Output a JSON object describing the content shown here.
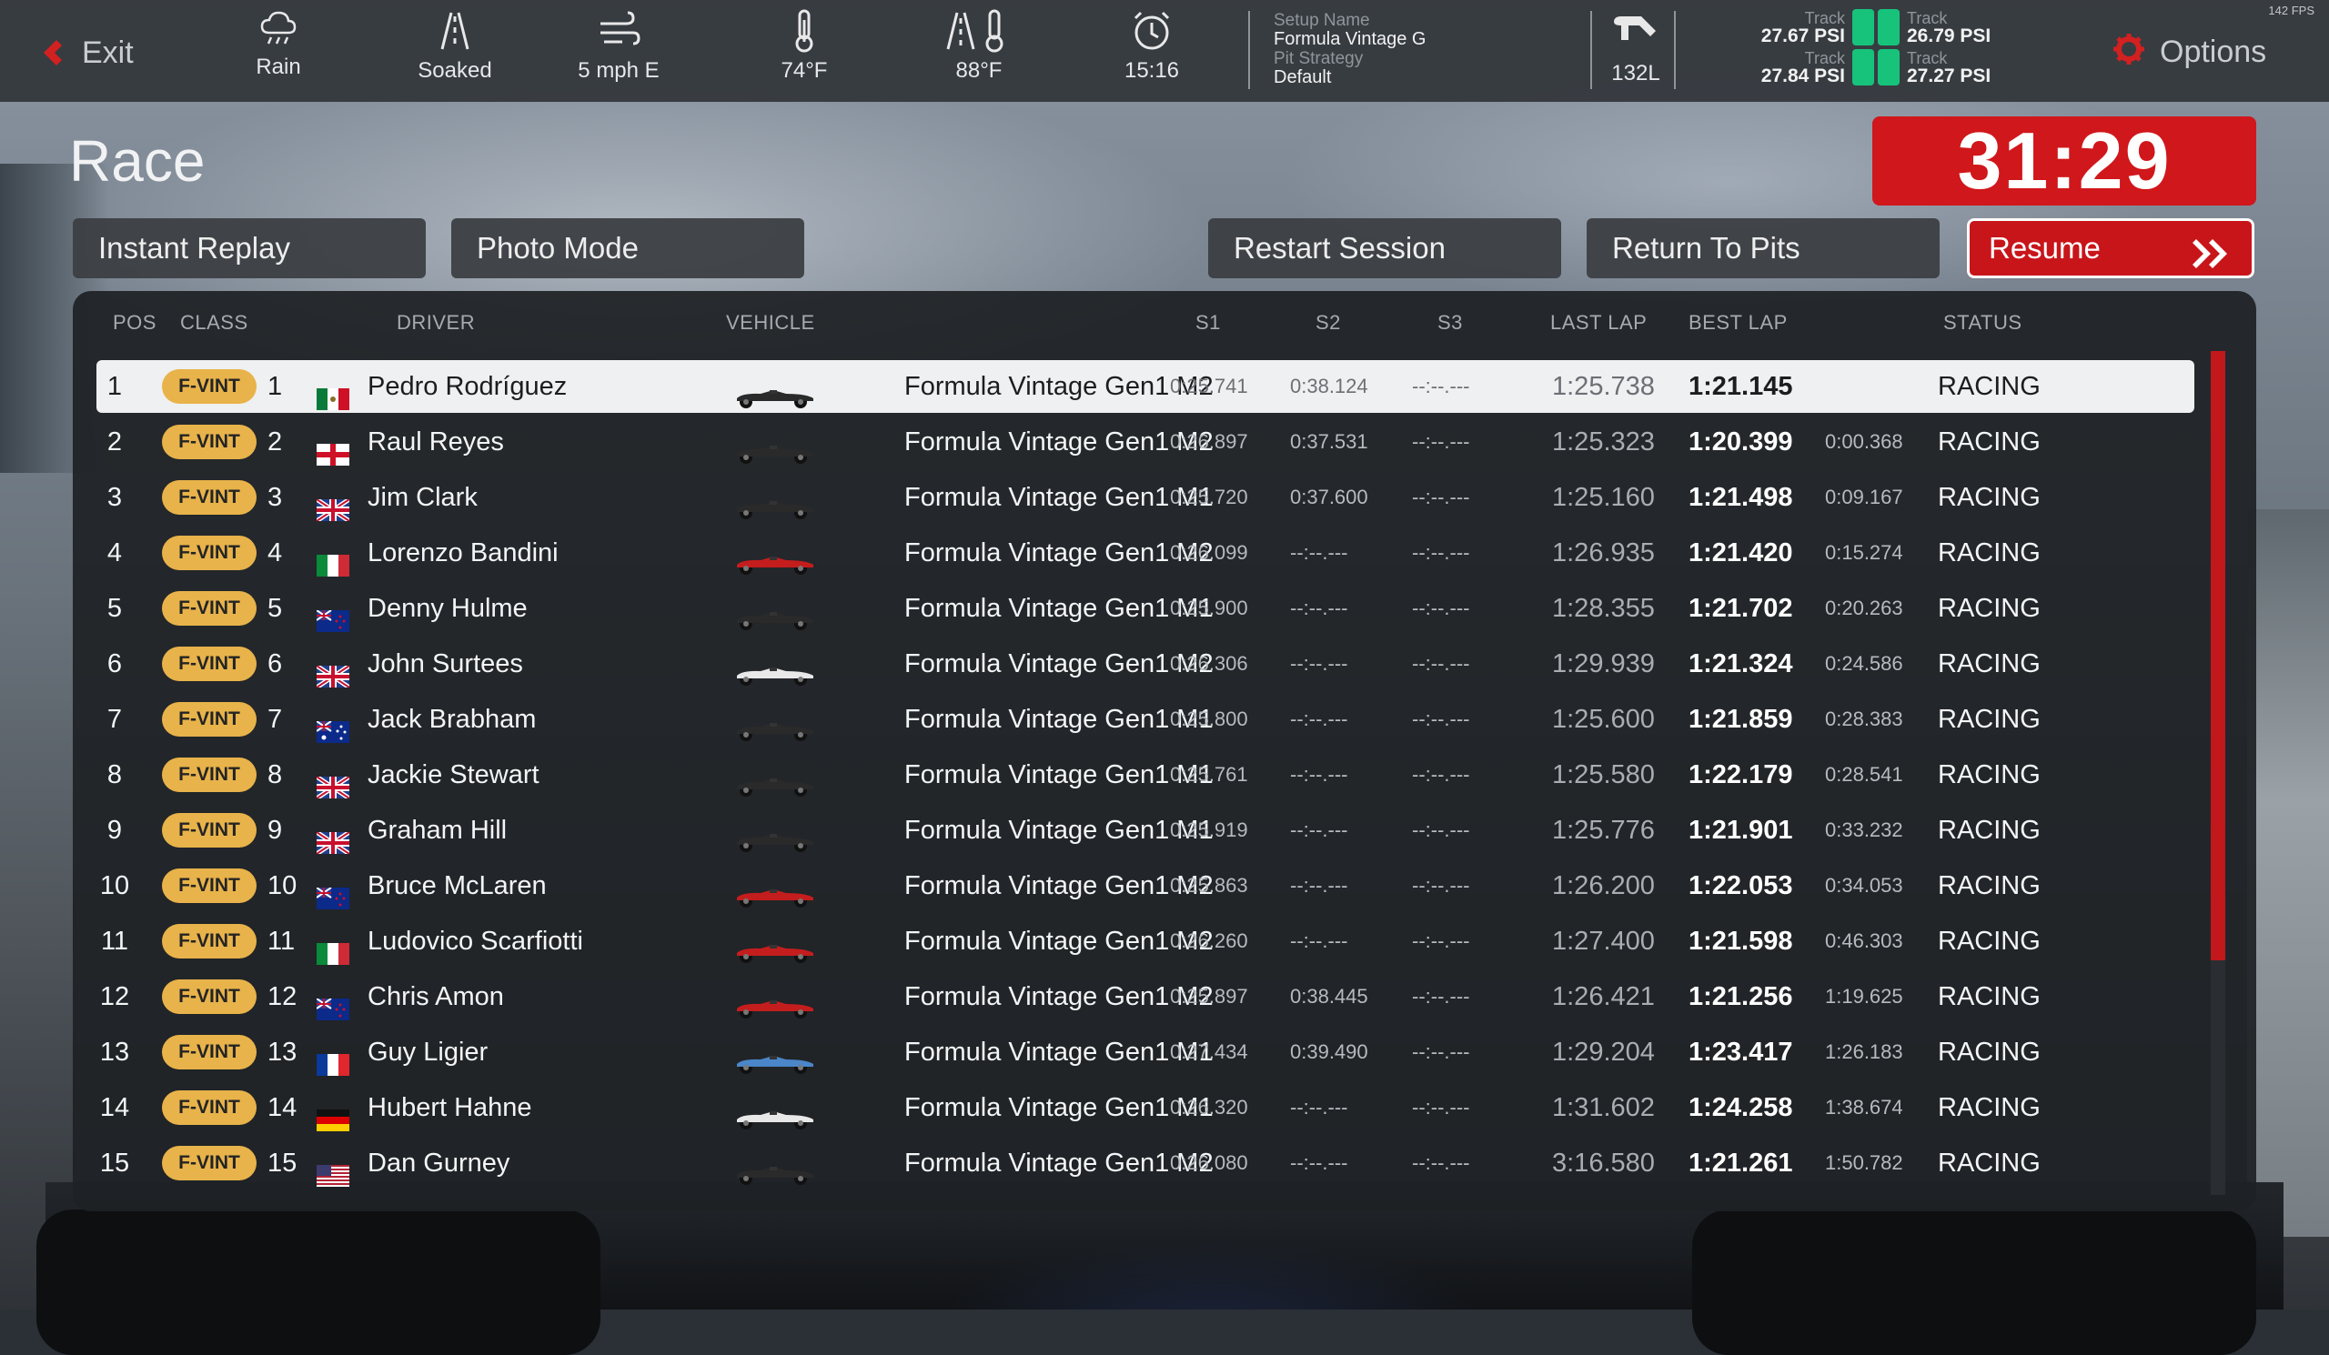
{
  "topbar": {
    "exit_label": "Exit",
    "weather": [
      {
        "icon": "rain-cloud-icon",
        "label": "Rain"
      },
      {
        "icon": "track-wetness-icon",
        "label": "Soaked"
      },
      {
        "icon": "wind-icon",
        "label": "5 mph E"
      },
      {
        "icon": "air-temperature-icon",
        "label": "74°F"
      },
      {
        "icon": "track-temperature-icon",
        "label": "88°F"
      },
      {
        "icon": "clock-icon",
        "label": "15:16"
      }
    ],
    "setup": {
      "name_key": "Setup Name",
      "name_value": "Formula Vintage G",
      "strategy_key": "Pit Strategy",
      "strategy_value": "Default"
    },
    "fuel": {
      "icon": "fuel-nozzle-icon",
      "label": "132L"
    },
    "tyres": {
      "fl": {
        "key": "Track",
        "value": "27.67 PSI"
      },
      "fr": {
        "key": "Track",
        "value": "26.79 PSI"
      },
      "rl": {
        "key": "Track",
        "value": "27.84 PSI"
      },
      "rr": {
        "key": "Track",
        "value": "27.27 PSI"
      }
    },
    "options_label": "Options",
    "fps": "142 FPS"
  },
  "page": {
    "title": "Race",
    "timer": "31:29"
  },
  "buttons": {
    "instant_replay": "Instant Replay",
    "photo_mode": "Photo Mode",
    "restart_session": "Restart Session",
    "return_to_pits": "Return To Pits",
    "resume": "Resume"
  },
  "table": {
    "headers": {
      "pos": "POS",
      "class": "CLASS",
      "driver": "DRIVER",
      "vehicle": "VEHICLE",
      "s1": "S1",
      "s2": "S2",
      "s3": "S3",
      "last_lap": "LAST LAP",
      "best_lap": "BEST LAP",
      "status": "STATUS"
    },
    "rows": [
      {
        "pos": "1",
        "class": "F-VINT",
        "num": "1",
        "flag": "mexico",
        "driver": "Pedro Rodríguez",
        "car_color": "#2a2a2a",
        "vehicle": "Formula Vintage Gen1 M2",
        "s1": "0:25.741",
        "s2": "0:38.124",
        "s3": "--:--.---",
        "last": "1:25.738",
        "best": "1:21.145",
        "gap": "",
        "status": "RACING"
      },
      {
        "pos": "2",
        "class": "F-VINT",
        "num": "2",
        "flag": "england",
        "driver": "Raul Reyes",
        "car_color": "#2a2a2a",
        "vehicle": "Formula Vintage Gen1 M2",
        "s1": "0:26.897",
        "s2": "0:37.531",
        "s3": "--:--.---",
        "last": "1:25.323",
        "best": "1:20.399",
        "gap": "0:00.368",
        "status": "RACING"
      },
      {
        "pos": "3",
        "class": "F-VINT",
        "num": "3",
        "flag": "uk",
        "driver": "Jim Clark",
        "car_color": "#2a2a2a",
        "vehicle": "Formula Vintage Gen1 M1",
        "s1": "0:25.720",
        "s2": "0:37.600",
        "s3": "--:--.---",
        "last": "1:25.160",
        "best": "1:21.498",
        "gap": "0:09.167",
        "status": "RACING"
      },
      {
        "pos": "4",
        "class": "F-VINT",
        "num": "4",
        "flag": "italy",
        "driver": "Lorenzo Bandini",
        "car_color": "#c41d1d",
        "vehicle": "Formula Vintage Gen1 M2",
        "s1": "0:26.099",
        "s2": "--:--.---",
        "s3": "--:--.---",
        "last": "1:26.935",
        "best": "1:21.420",
        "gap": "0:15.274",
        "status": "RACING"
      },
      {
        "pos": "5",
        "class": "F-VINT",
        "num": "5",
        "flag": "new-zealand",
        "driver": "Denny Hulme",
        "car_color": "#2a2a2a",
        "vehicle": "Formula Vintage Gen1 M1",
        "s1": "0:25.900",
        "s2": "--:--.---",
        "s3": "--:--.---",
        "last": "1:28.355",
        "best": "1:21.702",
        "gap": "0:20.263",
        "status": "RACING"
      },
      {
        "pos": "6",
        "class": "F-VINT",
        "num": "6",
        "flag": "uk",
        "driver": "John Surtees",
        "car_color": "#e8e8e8",
        "vehicle": "Formula Vintage Gen1 M2",
        "s1": "0:26.306",
        "s2": "--:--.---",
        "s3": "--:--.---",
        "last": "1:29.939",
        "best": "1:21.324",
        "gap": "0:24.586",
        "status": "RACING"
      },
      {
        "pos": "7",
        "class": "F-VINT",
        "num": "7",
        "flag": "australia",
        "driver": "Jack Brabham",
        "car_color": "#2a2a2a",
        "vehicle": "Formula Vintage Gen1 M1",
        "s1": "0:25.800",
        "s2": "--:--.---",
        "s3": "--:--.---",
        "last": "1:25.600",
        "best": "1:21.859",
        "gap": "0:28.383",
        "status": "RACING"
      },
      {
        "pos": "8",
        "class": "F-VINT",
        "num": "8",
        "flag": "uk",
        "driver": "Jackie Stewart",
        "car_color": "#2a2a2a",
        "vehicle": "Formula Vintage Gen1 M1",
        "s1": "0:25.761",
        "s2": "--:--.---",
        "s3": "--:--.---",
        "last": "1:25.580",
        "best": "1:22.179",
        "gap": "0:28.541",
        "status": "RACING"
      },
      {
        "pos": "9",
        "class": "F-VINT",
        "num": "9",
        "flag": "uk",
        "driver": "Graham Hill",
        "car_color": "#2a2a2a",
        "vehicle": "Formula Vintage Gen1 M1",
        "s1": "0:25.919",
        "s2": "--:--.---",
        "s3": "--:--.---",
        "last": "1:25.776",
        "best": "1:21.901",
        "gap": "0:33.232",
        "status": "RACING"
      },
      {
        "pos": "10",
        "class": "F-VINT",
        "num": "10",
        "flag": "new-zealand",
        "driver": "Bruce McLaren",
        "car_color": "#c41d1d",
        "vehicle": "Formula Vintage Gen1 M2",
        "s1": "0:25.863",
        "s2": "--:--.---",
        "s3": "--:--.---",
        "last": "1:26.200",
        "best": "1:22.053",
        "gap": "0:34.053",
        "status": "RACING"
      },
      {
        "pos": "11",
        "class": "F-VINT",
        "num": "11",
        "flag": "italy",
        "driver": "Ludovico Scarfiotti",
        "car_color": "#c41d1d",
        "vehicle": "Formula Vintage Gen1 M2",
        "s1": "0:26.260",
        "s2": "--:--.---",
        "s3": "--:--.---",
        "last": "1:27.400",
        "best": "1:21.598",
        "gap": "0:46.303",
        "status": "RACING"
      },
      {
        "pos": "12",
        "class": "F-VINT",
        "num": "12",
        "flag": "new-zealand",
        "driver": "Chris Amon",
        "car_color": "#c41d1d",
        "vehicle": "Formula Vintage Gen1 M2",
        "s1": "0:25.897",
        "s2": "0:38.445",
        "s3": "--:--.---",
        "last": "1:26.421",
        "best": "1:21.256",
        "gap": "1:19.625",
        "status": "RACING"
      },
      {
        "pos": "13",
        "class": "F-VINT",
        "num": "13",
        "flag": "france",
        "driver": "Guy Ligier",
        "car_color": "#4a86c8",
        "vehicle": "Formula Vintage Gen1 M1",
        "s1": "0:27.434",
        "s2": "0:39.490",
        "s3": "--:--.---",
        "last": "1:29.204",
        "best": "1:23.417",
        "gap": "1:26.183",
        "status": "RACING"
      },
      {
        "pos": "14",
        "class": "F-VINT",
        "num": "14",
        "flag": "germany",
        "driver": "Hubert Hahne",
        "car_color": "#e8e8e8",
        "vehicle": "Formula Vintage Gen1 M1",
        "s1": "0:26.320",
        "s2": "--:--.---",
        "s3": "--:--.---",
        "last": "1:31.602",
        "best": "1:24.258",
        "gap": "1:38.674",
        "status": "RACING"
      },
      {
        "pos": "15",
        "class": "F-VINT",
        "num": "15",
        "flag": "usa",
        "driver": "Dan Gurney",
        "car_color": "#2a2a2a",
        "vehicle": "Formula Vintage Gen1 M2",
        "s1": "0:26.080",
        "s2": "--:--.---",
        "s3": "--:--.---",
        "last": "3:16.580",
        "best": "1:21.261",
        "gap": "1:50.782",
        "status": "RACING"
      }
    ]
  },
  "colors": {
    "accent_red": "#d0171b",
    "class_badge": "#e8b34a",
    "tyre_ok": "#17c37b"
  }
}
